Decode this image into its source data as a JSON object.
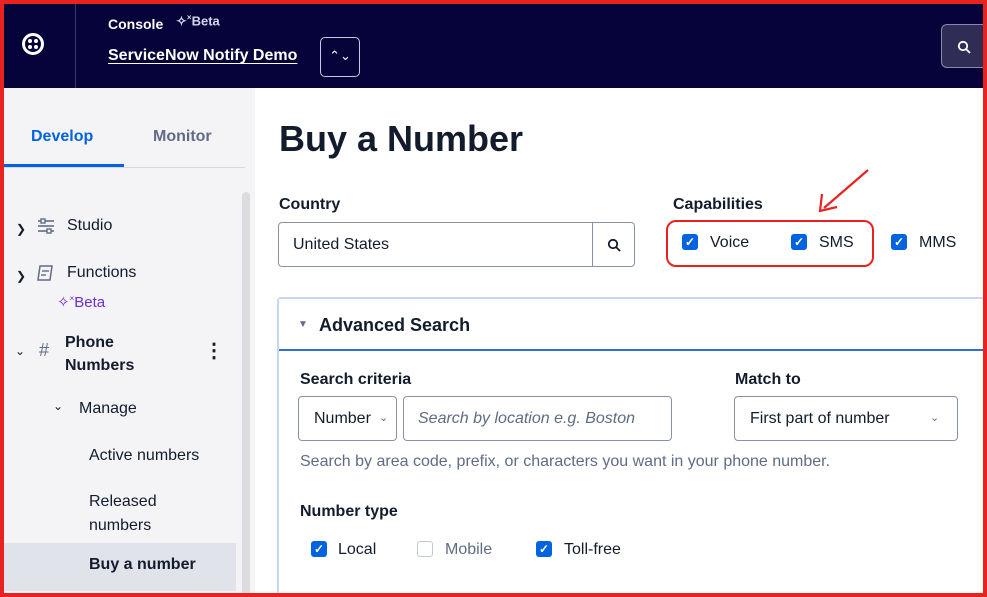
{
  "header": {
    "console_label": "Console",
    "beta_label": "Beta",
    "account_name": "ServiceNow Notify Demo",
    "switch_glyph": "⌃⌄",
    "search_glyph": "🔍"
  },
  "sidebar": {
    "tabs": [
      {
        "label": "Develop",
        "active": true
      },
      {
        "label": "Monitor",
        "active": false
      }
    ],
    "items": {
      "studio": "Studio",
      "functions": "Functions",
      "functions_badge": "Beta",
      "phone_numbers_1": "Phone",
      "phone_numbers_2": "Numbers",
      "manage": "Manage",
      "active_numbers": "Active numbers",
      "released_1": "Released",
      "released_2": "numbers",
      "buy_number": "Buy a number"
    }
  },
  "main": {
    "title": "Buy a Number",
    "country": {
      "label": "Country",
      "value": "United States"
    },
    "capabilities": {
      "label": "Capabilities",
      "options": [
        {
          "label": "Voice",
          "checked": true
        },
        {
          "label": "SMS",
          "checked": true
        },
        {
          "label": "MMS",
          "checked": true
        }
      ]
    },
    "advanced_search": {
      "title": "Advanced Search",
      "search_criteria_label": "Search criteria",
      "criteria_value": "Number",
      "search_placeholder": "Search by location e.g. Boston",
      "match_to_label": "Match to",
      "match_to_value": "First part of number",
      "help_text": "Search by area code, prefix, or characters you want in your phone number.",
      "number_type_label": "Number type",
      "number_types": [
        {
          "label": "Local",
          "checked": true
        },
        {
          "label": "Mobile",
          "checked": false
        },
        {
          "label": "Toll-free",
          "checked": true
        }
      ]
    }
  },
  "colors": {
    "nav_bg": "#06033a",
    "accent": "#0263e0",
    "highlight": "#e8231f",
    "beta_purple": "#6d2ed1"
  }
}
